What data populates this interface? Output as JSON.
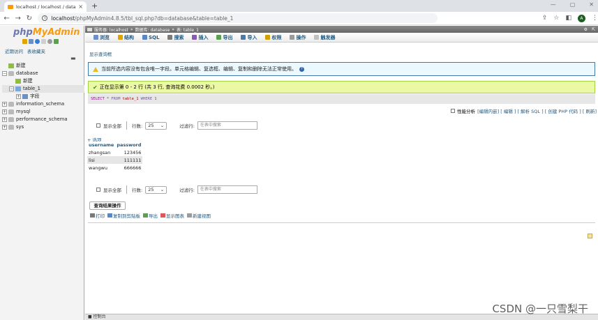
{
  "browser": {
    "tab_title": "localhost / localhost / databas",
    "tab_close": "×",
    "new_tab": "+",
    "url_host": "localhost",
    "url_path": "/phpMyAdmin4.8.5/tbl_sql.php?db=database&table=table_1",
    "profile_initial": "A"
  },
  "sidebar": {
    "logo_php": "php",
    "logo_my": "MyAdmin",
    "recent": "近期访问",
    "favorites": "表收藏夹",
    "tree": [
      {
        "label": "新建",
        "depth": 0,
        "expander": "",
        "icon": "new"
      },
      {
        "label": "database",
        "depth": 0,
        "expander": "−",
        "icon": "db"
      },
      {
        "label": "新建",
        "depth": 1,
        "expander": "",
        "icon": "new"
      },
      {
        "label": "table_1",
        "depth": 1,
        "expander": "−",
        "icon": "tbl",
        "selected": true
      },
      {
        "label": "字段",
        "depth": 2,
        "expander": "+",
        "icon": "col"
      },
      {
        "label": "information_schema",
        "depth": 0,
        "expander": "+",
        "icon": "db"
      },
      {
        "label": "mysql",
        "depth": 0,
        "expander": "+",
        "icon": "db"
      },
      {
        "label": "performance_schema",
        "depth": 0,
        "expander": "+",
        "icon": "db"
      },
      {
        "label": "sys",
        "depth": 0,
        "expander": "+",
        "icon": "db"
      }
    ]
  },
  "breadcrumb": {
    "server": "服务器: localhost",
    "db": "数据库: database",
    "table": "表: table_1"
  },
  "menu": [
    "浏览",
    "结构",
    "SQL",
    "搜索",
    "插入",
    "导出",
    "导入",
    "权限",
    "操作",
    "触发器"
  ],
  "show_query_box": "显示查询框",
  "warning": "当前所选内容没有包含唯一字段。单元格编辑、复选框、编辑、复制和删除无法正常使用。",
  "success": "正在显示第 0 - 2 行 (共 3 行, 查询花费 0.0002 秒。)",
  "sql": {
    "select": "SELECT",
    "star": "*",
    "from": "FROM",
    "table": "table_1",
    "where": "WHERE",
    "one": "1"
  },
  "profiling": {
    "label": "性能分析",
    "links": "[编辑内嵌] [ 编辑 ] [ 解析 SQL ] [ 创建 PHP 代码 ] [ 刷新]"
  },
  "nav": {
    "show_all": "显示全部",
    "rows_label": "行数:",
    "rows_value": "25",
    "filter_label": "过滤行:",
    "filter_placeholder": "在表中搜索"
  },
  "options": "+ 选项",
  "table": {
    "headers": [
      "username",
      "password"
    ],
    "rows": [
      [
        "zhangsan",
        "123456"
      ],
      [
        "lisi",
        "111111"
      ],
      [
        "wangwu",
        "666666"
      ]
    ]
  },
  "query_results": {
    "title": "查询结果操作",
    "ops": [
      "打印",
      "复制到剪贴板",
      "导出",
      "显示图表",
      "新建视图"
    ]
  },
  "console": "控制台",
  "watermark": "CSDN @一只雪梨干",
  "colors": {
    "accent": "#235a81",
    "logo_blue": "#6c78af",
    "logo_orange": "#f89c0e",
    "success_bg": "#ebf8a4",
    "notice_bg": "#ebf8fd"
  }
}
